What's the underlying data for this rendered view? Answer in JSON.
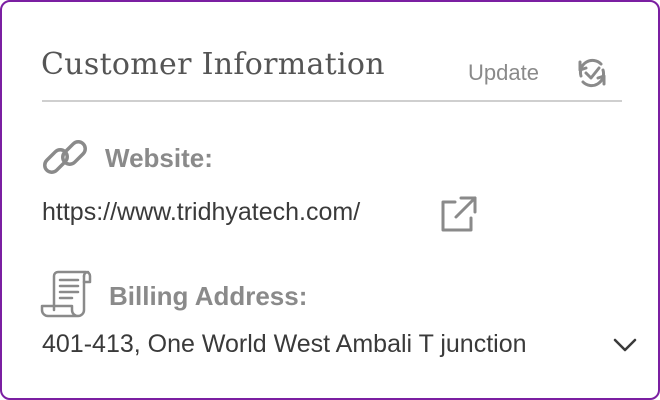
{
  "card": {
    "title": "Customer Information",
    "update_label": "Update",
    "sync_icon": "sync-check-icon",
    "border_color": "#7b1fa2"
  },
  "website": {
    "icon": "link-icon",
    "label": "Website:",
    "url": "https://www.tridhyatech.com/",
    "open_icon": "external-link-icon"
  },
  "billing": {
    "icon": "scroll-document-icon",
    "label": "Billing Address:",
    "address": "401-413, One World West Ambali T junction",
    "expand_icon": "chevron-down-icon"
  }
}
